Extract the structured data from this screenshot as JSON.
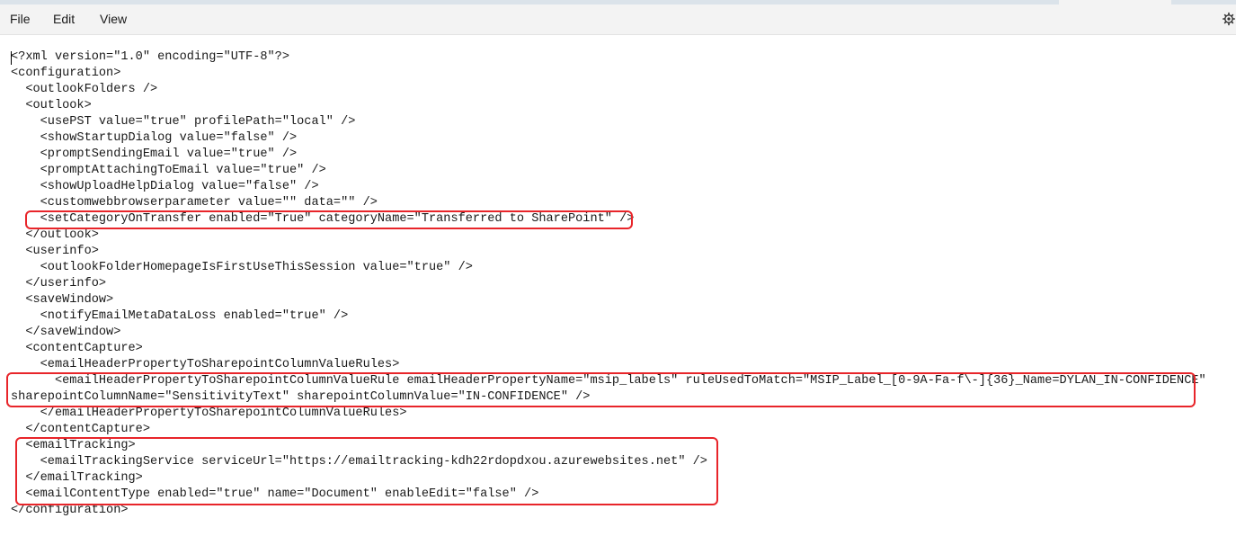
{
  "menu": {
    "file": "File",
    "edit": "Edit",
    "view": "View"
  },
  "icons": {
    "settings": "gear-icon"
  },
  "colors": {
    "highlight": "#e8252a",
    "menubar": "#f3f3f3"
  },
  "document": {
    "lines": [
      "<?xml version=\"1.0\" encoding=\"UTF-8\"?>",
      "<configuration>",
      "  <outlookFolders />",
      "  <outlook>",
      "    <usePST value=\"true\" profilePath=\"local\" />",
      "    <showStartupDialog value=\"false\" />",
      "    <promptSendingEmail value=\"true\" />",
      "    <promptAttachingToEmail value=\"true\" />",
      "    <showUploadHelpDialog value=\"false\" />",
      "    <customwebbrowserparameter value=\"\" data=\"\" />",
      "    <setCategoryOnTransfer enabled=\"True\" categoryName=\"Transferred to SharePoint\" />",
      "  </outlook>",
      "  <userinfo>",
      "    <outlookFolderHomepageIsFirstUseThisSession value=\"true\" />",
      "  </userinfo>",
      "  <saveWindow>",
      "    <notifyEmailMetaDataLoss enabled=\"true\" />",
      "  </saveWindow>",
      "  <contentCapture>",
      "    <emailHeaderPropertyToSharepointColumnValueRules>",
      "      <emailHeaderPropertyToSharepointColumnValueRule emailHeaderPropertyName=\"msip_labels\" ruleUsedToMatch=\"MSIP_Label_[0-9A-Fa-f\\-]{36}_Name=DYLAN_IN-CONFIDENCE\"",
      "sharepointColumnName=\"SensitivityText\" sharepointColumnValue=\"IN-CONFIDENCE\" />",
      "    </emailHeaderPropertyToSharepointColumnValueRules>",
      "  </contentCapture>",
      "  <emailTracking>",
      "    <emailTrackingService serviceUrl=\"https://emailtracking-kdh22rdopdxou.azurewebsites.net\" />",
      "  </emailTracking>",
      "  <emailContentType enabled=\"true\" name=\"Document\" enableEdit=\"false\" />",
      "</configuration>"
    ]
  }
}
